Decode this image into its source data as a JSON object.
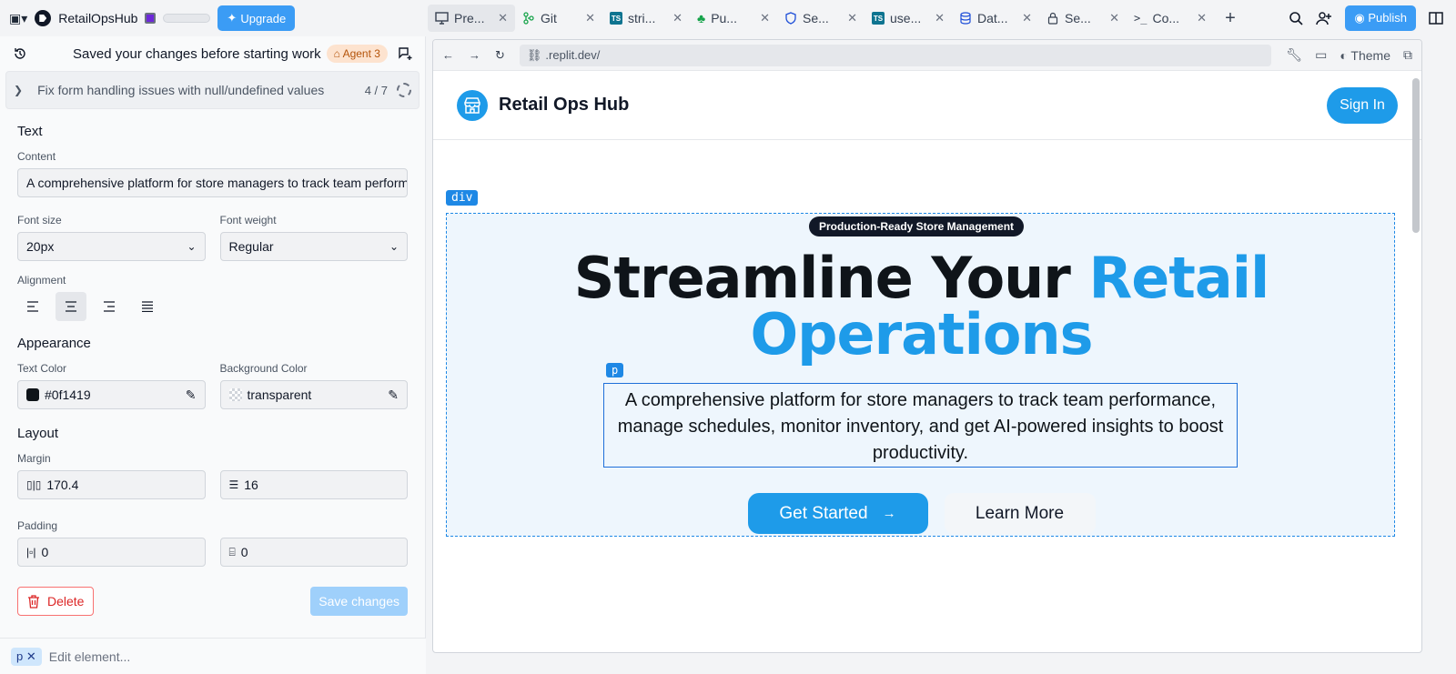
{
  "app": {
    "name": "RetailOpsHub",
    "upgrade_label": "Upgrade",
    "publish_label": "Publish"
  },
  "tabs": [
    {
      "label": "Pre...",
      "icon": "monitor-icon"
    },
    {
      "label": "Git",
      "icon": "git-icon"
    },
    {
      "label": "stri...",
      "icon": "typescript-icon"
    },
    {
      "label": "Pu...",
      "icon": "tree-icon"
    },
    {
      "label": "Se...",
      "icon": "shield-icon"
    },
    {
      "label": "use...",
      "icon": "typescript-icon"
    },
    {
      "label": "Dat...",
      "icon": "database-icon"
    },
    {
      "label": "Se...",
      "icon": "lock-icon"
    },
    {
      "label": "Co...",
      "icon": "terminal-icon"
    }
  ],
  "agent": {
    "saved_text": "Saved your changes before starting work",
    "badge": "Agent 3",
    "task": "Fix form handling issues with null/undefined values",
    "task_count": "4 / 7"
  },
  "editor": {
    "text_section": "Text",
    "content_label": "Content",
    "content_value": "A comprehensive platform for store managers to track team performance, manage schedules, monitor inventory, and get AI-powered insights to boost productivity.",
    "font_size_label": "Font size",
    "font_size_value": "20px",
    "font_weight_label": "Font weight",
    "font_weight_value": "Regular",
    "alignment_label": "Alignment",
    "appearance_section": "Appearance",
    "text_color_label": "Text Color",
    "text_color_value": "#0f1419",
    "bg_color_label": "Background Color",
    "bg_color_value": "transparent",
    "layout_section": "Layout",
    "margin_label": "Margin",
    "margin_x": "170.4",
    "margin_y": "16",
    "padding_label": "Padding",
    "padding_x": "0",
    "padding_y": "0",
    "delete_label": "Delete",
    "save_label": "Save changes",
    "chip": "p",
    "edit_placeholder": "Edit element..."
  },
  "preview": {
    "url": ".replit.dev/",
    "theme_label": "Theme",
    "site_name": "Retail Ops Hub",
    "signin": "Sign In",
    "div_tag": "div",
    "p_tag": "p",
    "badge": "Production-Ready Store Management",
    "headline_dark": "Streamline Your ",
    "headline_blue_1": "Retail",
    "headline_blue_2": "Operations",
    "paragraph": "A comprehensive platform for store managers to track team performance, manage schedules, monitor inventory, and get AI-powered insights to boost productivity.",
    "cta_primary": "Get Started",
    "cta_secondary": "Learn More"
  },
  "colors": {
    "accent": "#1e9be9",
    "text": "#0f1419"
  }
}
